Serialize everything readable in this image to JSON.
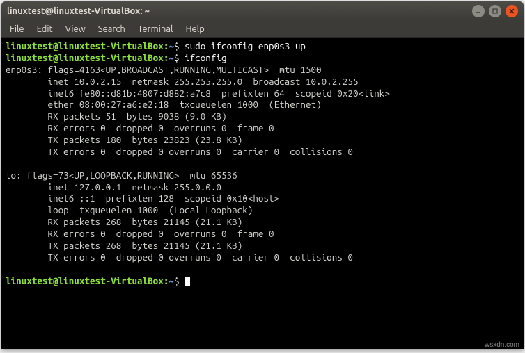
{
  "titlebar": {
    "title": "linuxtest@linuxtest-VirtualBox: ~"
  },
  "menubar": {
    "file": "File",
    "edit": "Edit",
    "view": "View",
    "search": "Search",
    "terminal": "Terminal",
    "help": "Help"
  },
  "prompt": {
    "userhost": "linuxtest@linuxtest-VirtualBox",
    "sep": ":",
    "path": "~",
    "symbol": "$"
  },
  "terminal": {
    "cmd1": "sudo ifconfig enp0s3 up",
    "cmd2": "ifconfig",
    "output": "enp0s3: flags=4163<UP,BROADCAST,RUNNING,MULTICAST>  mtu 1500\n        inet 10.0.2.15  netmask 255.255.255.0  broadcast 10.0.2.255\n        inet6 fe80::d81b:4807:d882:a7c8  prefixlen 64  scopeid 0x20<link>\n        ether 08:00:27:a6:e2:18  txqueuelen 1000  (Ethernet)\n        RX packets 51  bytes 9038 (9.0 KB)\n        RX errors 0  dropped 0  overruns 0  frame 0\n        TX packets 180  bytes 23823 (23.8 KB)\n        TX errors 0  dropped 0 overruns 0  carrier 0  collisions 0\n\nlo: flags=73<UP,LOOPBACK,RUNNING>  mtu 65536\n        inet 127.0.0.1  netmask 255.0.0.0\n        inet6 ::1  prefixlen 128  scopeid 0x10<host>\n        loop  txqueuelen 1000  (Local Loopback)\n        RX packets 268  bytes 21145 (21.1 KB)\n        RX errors 0  dropped 0  overruns 0  frame 0\n        TX packets 268  bytes 21145 (21.1 KB)\n        TX errors 0  dropped 0 overruns 0  carrier 0  collisions 0\n"
  },
  "watermark": "wsxdn.com"
}
